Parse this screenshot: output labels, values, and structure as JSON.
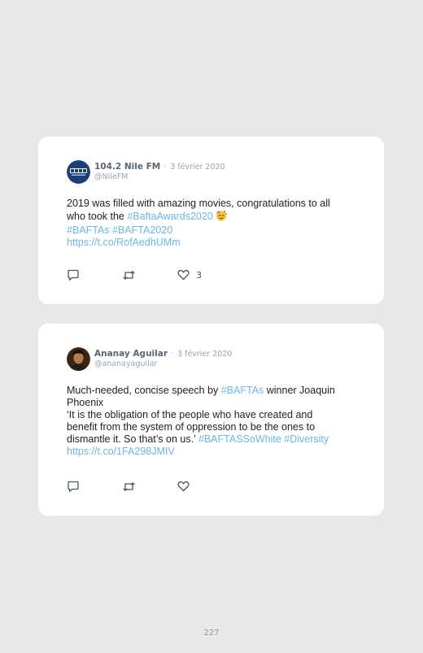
{
  "tweets": [
    {
      "author": "104.2 Nile FM",
      "separator": "·",
      "date": "3 février 2020",
      "handle": "@NileFM",
      "avatar_icon": "nile-fm-logo",
      "text": {
        "line1": "2019 was filled with amazing movies, congratulations to all",
        "line2_prefix": "who took the ",
        "hashtag_bafta_awards": "#BaftaAwards2020",
        "emoji_icon": "party-face-emoji",
        "hashtag_baftas": "#BAFTAs",
        "hashtag_bafta2020": "#BAFTA2020",
        "link": "https://t.co/RofAedhUMm"
      },
      "likes": "3"
    },
    {
      "author": "Ananay Aguilar",
      "separator": "·",
      "date": "3 février 2020",
      "handle": "@ananayaguilar",
      "avatar_icon": "profile-photo",
      "text": {
        "line1_prefix": "Much-needed, concise speech by ",
        "hashtag_baftas": "#BAFTAs",
        "line1_suffix": " winner Joaquin",
        "line2": "Phoenix",
        "line3": "‘It is the obligation of the people who have created and",
        "line4": "benefit from the system of oppression to be the ones to",
        "line5_prefix": "dismantle it. So that’s on us.’ ",
        "hashtag_sowhite": "#BAFTASSoWhite",
        "hashtag_diversity": "#Diversity",
        "link": "https://t.co/1FA298JMIV"
      }
    }
  ],
  "icons": {
    "reply": "reply-icon",
    "retweet": "retweet-icon",
    "like": "heart-icon"
  },
  "colors": {
    "link": "#6ab7e6",
    "background": "#e8e8e8",
    "card": "#ffffff"
  },
  "page_number": "227"
}
